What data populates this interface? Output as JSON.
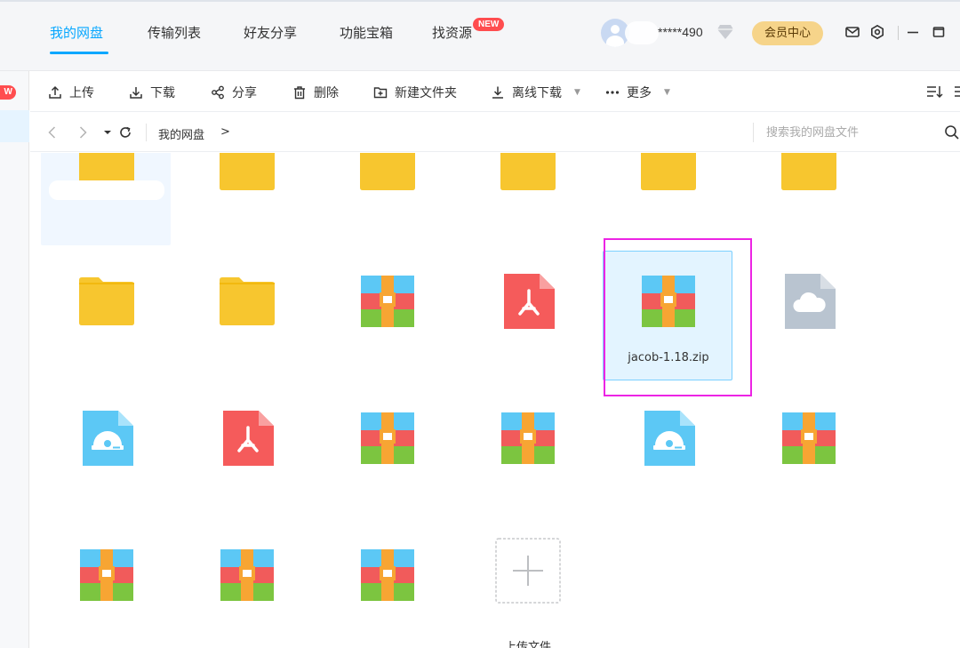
{
  "nav": {
    "tabs": [
      {
        "label": "我的网盘",
        "active": true
      },
      {
        "label": "传输列表",
        "active": false
      },
      {
        "label": "好友分享",
        "active": false
      },
      {
        "label": "功能宝箱",
        "active": false
      },
      {
        "label": "找资源",
        "active": false
      }
    ],
    "new_badge": "NEW",
    "username": "*****490",
    "vip_button": "会员中心"
  },
  "left_strip": {
    "badge": "W"
  },
  "toolbar": {
    "items": [
      {
        "label": "上传",
        "icon": "upload-icon"
      },
      {
        "label": "下载",
        "icon": "download-icon"
      },
      {
        "label": "分享",
        "icon": "share-icon"
      },
      {
        "label": "删除",
        "icon": "trash-icon"
      },
      {
        "label": "新建文件夹",
        "icon": "new-folder-icon"
      },
      {
        "label": "离线下载",
        "icon": "offline-download-icon",
        "caret": true
      },
      {
        "label": "更多",
        "icon": "more-icon",
        "caret": true
      }
    ]
  },
  "address": {
    "crumb": "我的网盘",
    "crumb_sep": ">",
    "search_placeholder": "搜索我的网盘文件"
  },
  "files": [
    {
      "type": "folder",
      "label": ""
    },
    {
      "type": "folder",
      "label": ""
    },
    {
      "type": "folder",
      "label": ""
    },
    {
      "type": "folder",
      "label": ""
    },
    {
      "type": "folder",
      "label": ""
    },
    {
      "type": "folder",
      "label": ""
    },
    {
      "type": "folder",
      "label": ""
    },
    {
      "type": "folder",
      "label": ""
    },
    {
      "type": "zip",
      "label": ""
    },
    {
      "type": "pdf",
      "label": ""
    },
    {
      "type": "zip",
      "label": "jacob-1.18.zip",
      "selected": true
    },
    {
      "type": "cloud",
      "label": ""
    },
    {
      "type": "disc",
      "label": ""
    },
    {
      "type": "pdf",
      "label": ""
    },
    {
      "type": "zip",
      "label": ""
    },
    {
      "type": "zip",
      "label": ""
    },
    {
      "type": "disc",
      "label": ""
    },
    {
      "type": "zip",
      "label": ""
    },
    {
      "type": "zip",
      "label": ""
    },
    {
      "type": "zip",
      "label": ""
    },
    {
      "type": "zip",
      "label": ""
    },
    {
      "type": "upload",
      "label": "上传文件"
    }
  ],
  "colors": {
    "accent": "#06a7ff",
    "folder": "#f7c62f",
    "highlight": "#ec24e4",
    "selected_bg": "#e3f4ff"
  }
}
